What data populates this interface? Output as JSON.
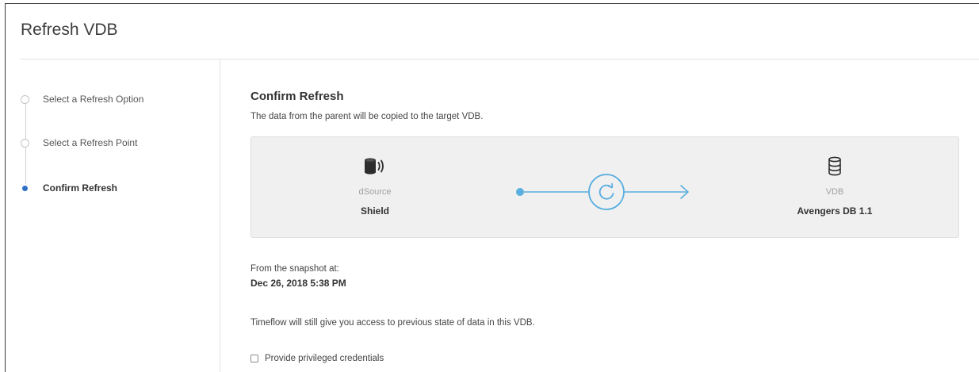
{
  "dialog": {
    "title": "Refresh VDB"
  },
  "steps": [
    {
      "label": "Select a Refresh Option",
      "active": false
    },
    {
      "label": "Select a Refresh Point",
      "active": false
    },
    {
      "label": "Confirm Refresh",
      "active": true
    }
  ],
  "content": {
    "title": "Confirm Refresh",
    "description": "The data from the parent will be copied to the target VDB.",
    "source": {
      "icon": "dsource-database-icon",
      "kind": "dSource",
      "name": "Shield"
    },
    "target": {
      "icon": "database-icon",
      "kind": "VDB",
      "name": "Avengers DB 1.1"
    },
    "connector_icon": "refresh-icon",
    "accent_color": "#5aaee0",
    "snapshot_label": "From the snapshot at:",
    "snapshot_value": "Dec 26, 2018 5:38 PM",
    "timeflow_note": "Timeflow will still give you access to previous state of data in this VDB.",
    "credentials_label": "Provide privileged credentials",
    "credentials_checked": false
  }
}
